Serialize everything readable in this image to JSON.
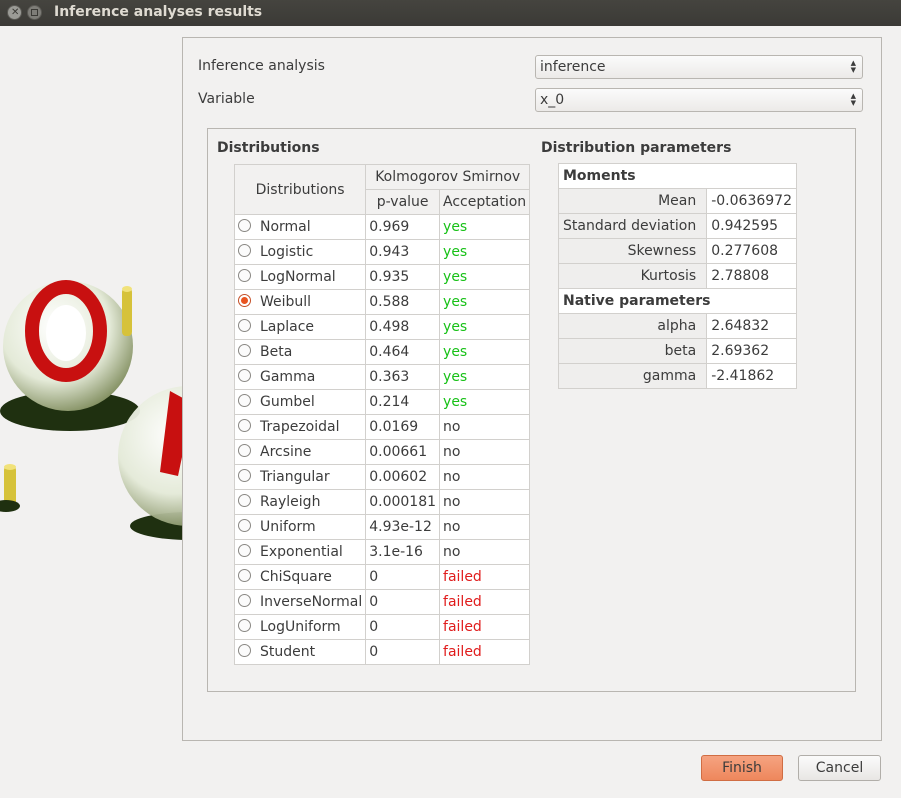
{
  "window": {
    "title": "Inference analyses results"
  },
  "form": {
    "analysis_label": "Inference analysis",
    "analysis_value": "inference",
    "variable_label": "Variable",
    "variable_value": "x_0"
  },
  "distributions": {
    "section_title": "Distributions",
    "col_distributions": "Distributions",
    "col_group": "Kolmogorov Smirnov",
    "col_pvalue": "p-value",
    "col_acceptance": "Acceptation",
    "rows": [
      {
        "name": "Normal",
        "pvalue": "0.969",
        "acceptance": "yes",
        "status": "yes",
        "selected": false
      },
      {
        "name": "Logistic",
        "pvalue": "0.943",
        "acceptance": "yes",
        "status": "yes",
        "selected": false
      },
      {
        "name": "LogNormal",
        "pvalue": "0.935",
        "acceptance": "yes",
        "status": "yes",
        "selected": false
      },
      {
        "name": "Weibull",
        "pvalue": "0.588",
        "acceptance": "yes",
        "status": "yes",
        "selected": true
      },
      {
        "name": "Laplace",
        "pvalue": "0.498",
        "acceptance": "yes",
        "status": "yes",
        "selected": false
      },
      {
        "name": "Beta",
        "pvalue": "0.464",
        "acceptance": "yes",
        "status": "yes",
        "selected": false
      },
      {
        "name": "Gamma",
        "pvalue": "0.363",
        "acceptance": "yes",
        "status": "yes",
        "selected": false
      },
      {
        "name": "Gumbel",
        "pvalue": "0.214",
        "acceptance": "yes",
        "status": "yes",
        "selected": false
      },
      {
        "name": "Trapezoidal",
        "pvalue": "0.0169",
        "acceptance": "no",
        "status": "no",
        "selected": false
      },
      {
        "name": "Arcsine",
        "pvalue": "0.00661",
        "acceptance": "no",
        "status": "no",
        "selected": false
      },
      {
        "name": "Triangular",
        "pvalue": "0.00602",
        "acceptance": "no",
        "status": "no",
        "selected": false
      },
      {
        "name": "Rayleigh",
        "pvalue": "0.000181",
        "acceptance": "no",
        "status": "no",
        "selected": false
      },
      {
        "name": "Uniform",
        "pvalue": "4.93e-12",
        "acceptance": "no",
        "status": "no",
        "selected": false
      },
      {
        "name": "Exponential",
        "pvalue": "3.1e-16",
        "acceptance": "no",
        "status": "no",
        "selected": false
      },
      {
        "name": "ChiSquare",
        "pvalue": "0",
        "acceptance": "failed",
        "status": "failed",
        "selected": false
      },
      {
        "name": "InverseNormal",
        "pvalue": "0",
        "acceptance": "failed",
        "status": "failed",
        "selected": false
      },
      {
        "name": "LogUniform",
        "pvalue": "0",
        "acceptance": "failed",
        "status": "failed",
        "selected": false
      },
      {
        "name": "Student",
        "pvalue": "0",
        "acceptance": "failed",
        "status": "failed",
        "selected": false
      }
    ]
  },
  "parameters": {
    "section_title": "Distribution parameters",
    "moments_header": "Moments",
    "moments": [
      {
        "label": "Mean",
        "value": "-0.0636972"
      },
      {
        "label": "Standard deviation",
        "value": "0.942595"
      },
      {
        "label": "Skewness",
        "value": "0.277608"
      },
      {
        "label": "Kurtosis",
        "value": "2.78808"
      }
    ],
    "native_header": "Native parameters",
    "native": [
      {
        "label": "alpha",
        "value": "2.64832"
      },
      {
        "label": "beta",
        "value": "2.69362"
      },
      {
        "label": "gamma",
        "value": "-2.41862"
      }
    ]
  },
  "buttons": {
    "finish": "Finish",
    "cancel": "Cancel"
  },
  "colors": {
    "accent": "#e95420",
    "yes": "#17c117",
    "failed": "#e01b1b"
  }
}
